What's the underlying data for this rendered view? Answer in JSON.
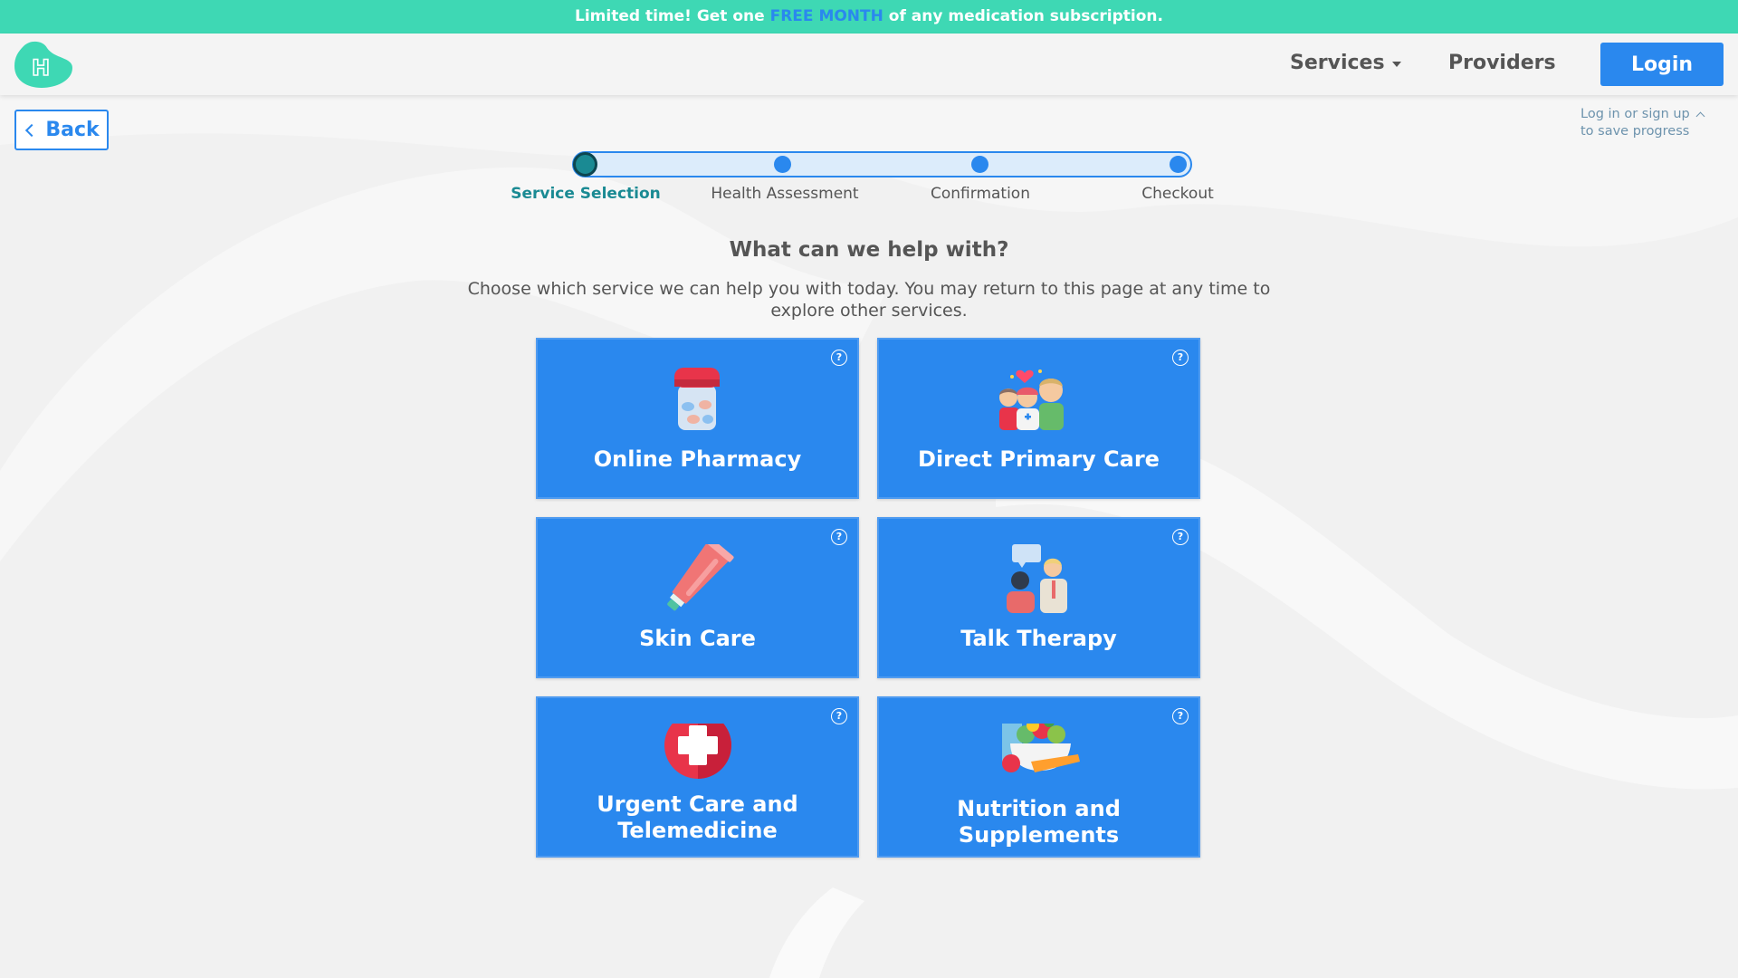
{
  "promo": {
    "before": "Limited time! Get one ",
    "highlight": "FREE MONTH",
    "after": " of any medication subscription."
  },
  "header": {
    "logo_letter": "H",
    "services_label": "Services",
    "providers_label": "Providers",
    "login_label": "Login"
  },
  "back_label": "Back",
  "save_progress": {
    "line1": "Log in or sign up",
    "line2": "to save progress"
  },
  "steps": [
    {
      "label": "Service Selection",
      "active": true
    },
    {
      "label": "Health Assessment",
      "active": false
    },
    {
      "label": "Confirmation",
      "active": false
    },
    {
      "label": "Checkout",
      "active": false
    }
  ],
  "main": {
    "title": "What can we help with?",
    "description": "Choose which service we can help you with today. You may return to this page at any time to explore other services."
  },
  "services": [
    {
      "label": "Online Pharmacy",
      "icon": "pill-jar-icon"
    },
    {
      "label": "Direct Primary Care",
      "icon": "family-doctor-icon"
    },
    {
      "label": "Skin Care",
      "icon": "cream-tube-icon"
    },
    {
      "label": "Talk Therapy",
      "icon": "therapy-session-icon"
    },
    {
      "label": "Urgent Care and Telemedicine",
      "icon": "medical-cross-icon"
    },
    {
      "label": "Nutrition and Supplements",
      "icon": "healthy-food-icon"
    }
  ],
  "help_glyph": "?",
  "colors": {
    "promo_bg": "#3ed8b4",
    "accent": "#2a88ee",
    "step_active": "#1a8a93",
    "page_bg": "#f1f1f1"
  }
}
